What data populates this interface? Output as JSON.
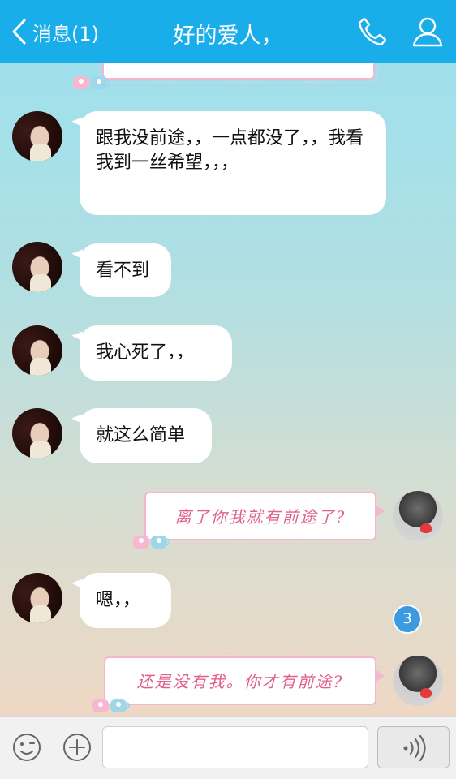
{
  "header": {
    "back_label": "消息(1)",
    "title": "好的爱人，",
    "background_color": "#19aeea"
  },
  "messages": [
    {
      "sender": "her",
      "type": "text",
      "text": "跟我没前途，，一点都没了，，我看我到一丝希望，，，"
    },
    {
      "sender": "her",
      "type": "text",
      "text": "看不到"
    },
    {
      "sender": "her",
      "type": "text",
      "text": "我心死了，，"
    },
    {
      "sender": "her",
      "type": "text",
      "text": "就这么简单"
    },
    {
      "sender": "me",
      "type": "sticker_text",
      "text": "离了你我就有前途了?"
    },
    {
      "sender": "her",
      "type": "text",
      "text": "嗯，，"
    },
    {
      "sender": "me",
      "type": "sticker_text",
      "text": "还是没有我。你才有前途?"
    }
  ],
  "unread_badge": "3",
  "input_bar": {
    "placeholder": "",
    "icons": [
      "emoji-icon",
      "plus-icon",
      "voice-icon"
    ]
  },
  "icons": [
    "chevron-left-icon",
    "phone-icon",
    "profile-icon"
  ]
}
